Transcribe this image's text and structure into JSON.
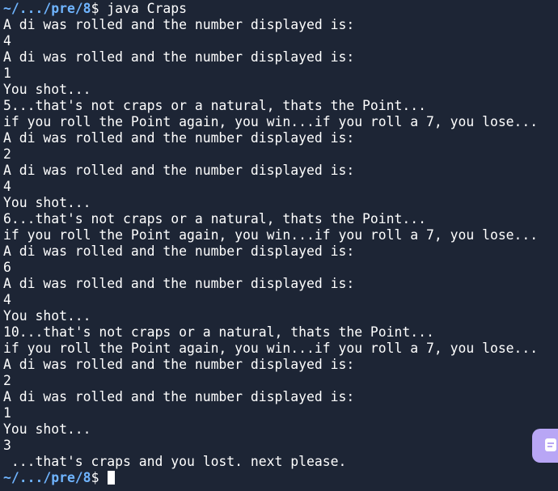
{
  "terminal": {
    "prompt_path": "~/.../pre/8",
    "prompt_symbol": "$",
    "command": " java Craps",
    "lines": [
      "A di was rolled and the number displayed is:",
      "4",
      "A di was rolled and the number displayed is:",
      "1",
      "You shot...",
      "5...that's not craps or a natural, thats the Point...",
      "if you roll the Point again, you win...if you roll a 7, you lose...",
      "A di was rolled and the number displayed is:",
      "2",
      "A di was rolled and the number displayed is:",
      "4",
      "You shot...",
      "6...that's not craps or a natural, thats the Point...",
      "if you roll the Point again, you win...if you roll a 7, you lose...",
      "A di was rolled and the number displayed is:",
      "6",
      "A di was rolled and the number displayed is:",
      "4",
      "You shot...",
      "10...that's not craps or a natural, thats the Point...",
      "if you roll the Point again, you win...if you roll a 7, you lose...",
      "A di was rolled and the number displayed is:",
      "2",
      "A di was rolled and the number displayed is:",
      "1",
      "You shot...",
      "3",
      " ...that's craps and you lost. next please."
    ],
    "final_prompt_path": "~/.../pre/8",
    "final_prompt_symbol": "$"
  },
  "colors": {
    "background": "#1d2535",
    "text": "#ffffff",
    "prompt_path": "#6fb4ff",
    "floating_button": "#b8a6f5"
  },
  "floating_button": {
    "icon": "message-icon"
  }
}
